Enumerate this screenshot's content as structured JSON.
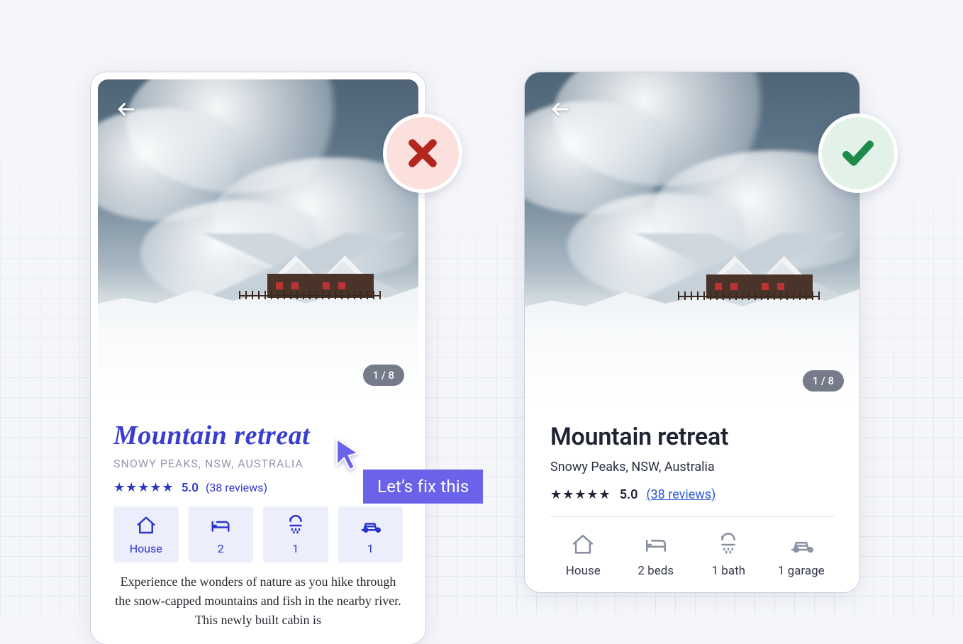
{
  "left": {
    "title": "Mountain retreat",
    "location": "SNOWY PEAKS, NSW, AUSTRALIA",
    "rating_score": "5.0",
    "rating_reviews": "(38 reviews)",
    "page_counter": "1 / 8",
    "features": [
      {
        "icon": "house",
        "label": "House"
      },
      {
        "icon": "bed",
        "label": "2"
      },
      {
        "icon": "shower",
        "label": "1"
      },
      {
        "icon": "car",
        "label": "1"
      }
    ],
    "description": "Experience the wonders of nature as you hike through the snow-capped mountains and fish in the nearby river. This newly built cabin is"
  },
  "right": {
    "title": "Mountain retreat",
    "location": "Snowy Peaks, NSW, Australia",
    "rating_score": "5.0",
    "rating_reviews": "(38 reviews)",
    "page_counter": "1 / 8",
    "features": [
      {
        "icon": "house",
        "label": "House"
      },
      {
        "icon": "bed",
        "label": "2 beds"
      },
      {
        "icon": "shower",
        "label": "1 bath"
      },
      {
        "icon": "car",
        "label": "1 garage"
      }
    ]
  },
  "tooltip": "Let’s fix this"
}
